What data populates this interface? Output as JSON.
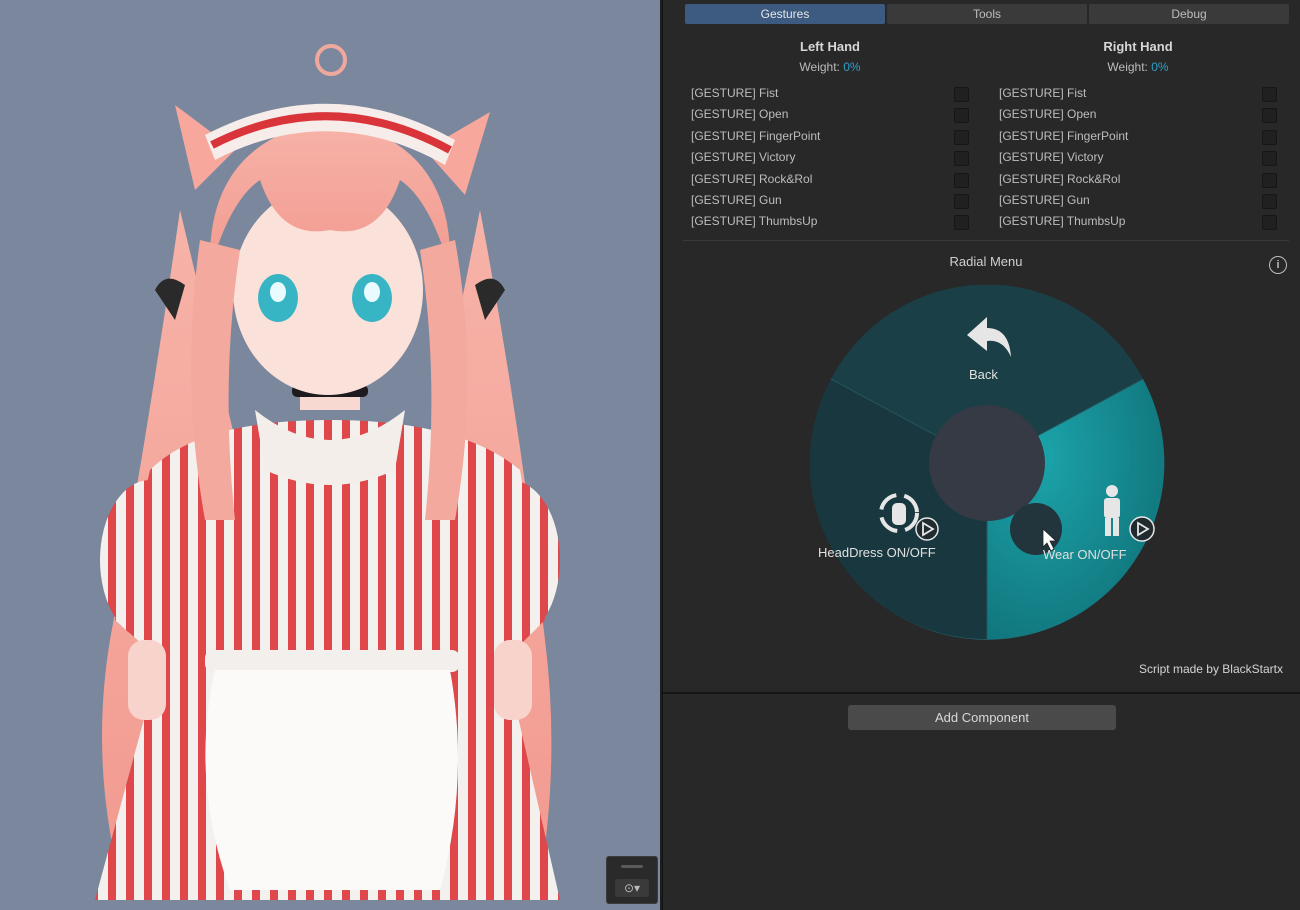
{
  "tabs": [
    {
      "label": "Gestures",
      "active": true
    },
    {
      "label": "Tools",
      "active": false
    },
    {
      "label": "Debug",
      "active": false
    }
  ],
  "left_hand": {
    "title": "Left Hand",
    "weight_label": "Weight:",
    "weight_value": "0%",
    "gestures": [
      "[GESTURE] Fist",
      "[GESTURE] Open",
      "[GESTURE] FingerPoint",
      "[GESTURE] Victory",
      "[GESTURE] Rock&Rol",
      "[GESTURE] Gun",
      "[GESTURE] ThumbsUp"
    ]
  },
  "right_hand": {
    "title": "Right Hand",
    "weight_label": "Weight:",
    "weight_value": "0%",
    "gestures": [
      "[GESTURE] Fist",
      "[GESTURE] Open",
      "[GESTURE] FingerPoint",
      "[GESTURE] Victory",
      "[GESTURE] Rock&Rol",
      "[GESTURE] Gun",
      "[GESTURE] ThumbsUp"
    ]
  },
  "radial_menu": {
    "title": "Radial Menu",
    "info_icon": "info-icon",
    "items": [
      {
        "label": "Back",
        "icon": "back-arrow-icon"
      },
      {
        "label": "HeadDress ON/OFF",
        "icon": "headdress-toggle-icon"
      },
      {
        "label": "Wear ON/OFF",
        "icon": "person-icon"
      }
    ]
  },
  "credit": "Script made by BlackStartx",
  "add_component_label": "Add Component",
  "colors": {
    "accent_blue": "#3d5a80",
    "weight_cyan": "#2fa0c8",
    "radial_teal": "#169aa0",
    "scene_bg": "#7a879c"
  }
}
